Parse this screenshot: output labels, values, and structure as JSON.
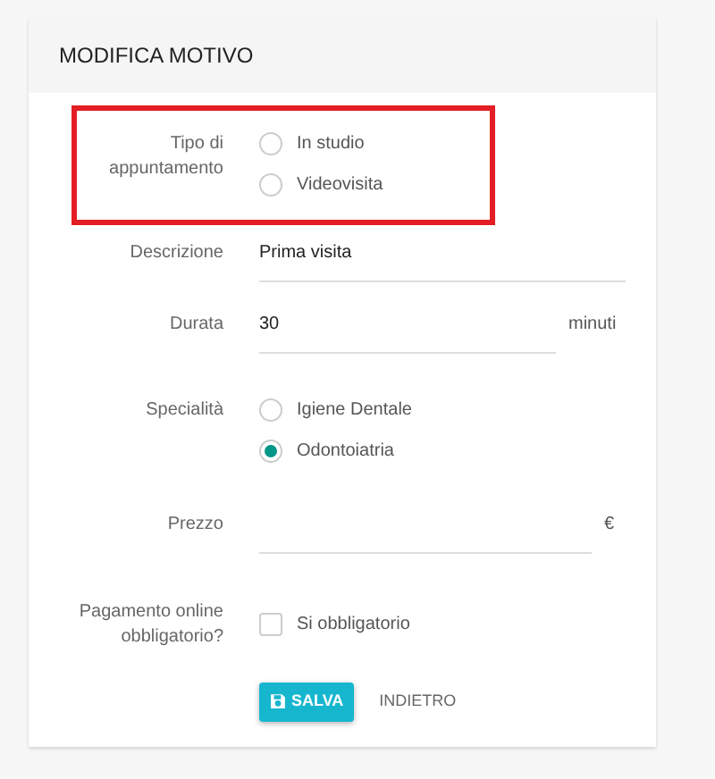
{
  "card": {
    "title": "MODIFICA MOTIVO"
  },
  "fields": [
    {
      "kind": "radio",
      "label": "Tipo di appuntamento",
      "highlighted": true,
      "options": [
        {
          "label": "In studio",
          "selected": false
        },
        {
          "label": "Videovisita",
          "selected": false
        }
      ]
    },
    {
      "kind": "text",
      "label": "Descrizione",
      "value": "Prima visita"
    },
    {
      "kind": "text",
      "label": "Durata",
      "value": "30",
      "suffix": "minuti"
    },
    {
      "kind": "radio",
      "label": "Specialità",
      "highlighted": false,
      "options": [
        {
          "label": "Igiene Dentale",
          "selected": false
        },
        {
          "label": "Odontoiatria",
          "selected": true
        }
      ]
    },
    {
      "kind": "text",
      "label": "Prezzo",
      "suffix": "€"
    },
    {
      "kind": "checkbox",
      "label": "Pagamento online obbligatorio?",
      "option": "Si obbligatorio",
      "checked": false
    }
  ],
  "buttons": {
    "save": "SALVA",
    "back": "INDIETRO"
  }
}
